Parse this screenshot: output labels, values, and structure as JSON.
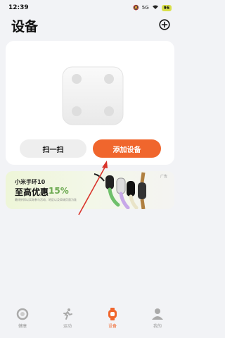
{
  "status_bar": {
    "time": "12:39",
    "signal_icons": "5G",
    "battery": "96"
  },
  "header": {
    "title": "设备",
    "add_icon": "plus-circle-icon"
  },
  "device_card": {
    "image_icon": "smart-scale",
    "scan_label": "扫一扫",
    "add_device_label": "添加设备"
  },
  "ad": {
    "tag": "广告",
    "line1": "小米手环10",
    "line2_prefix": "至高优惠",
    "line2_percent": "15%",
    "disclaimer": "最终折扣以实际参与活动、地区以及商城页面为准"
  },
  "tabs": [
    {
      "label": "健康",
      "icon": "ring-icon",
      "active": false
    },
    {
      "label": "运动",
      "icon": "runner-icon",
      "active": false
    },
    {
      "label": "设备",
      "icon": "watch-icon",
      "active": true
    },
    {
      "label": "我的",
      "icon": "person-icon",
      "active": false
    }
  ],
  "colors": {
    "accent": "#f0662d",
    "background": "#f2f3f6",
    "annotation_arrow": "#d9342b"
  }
}
